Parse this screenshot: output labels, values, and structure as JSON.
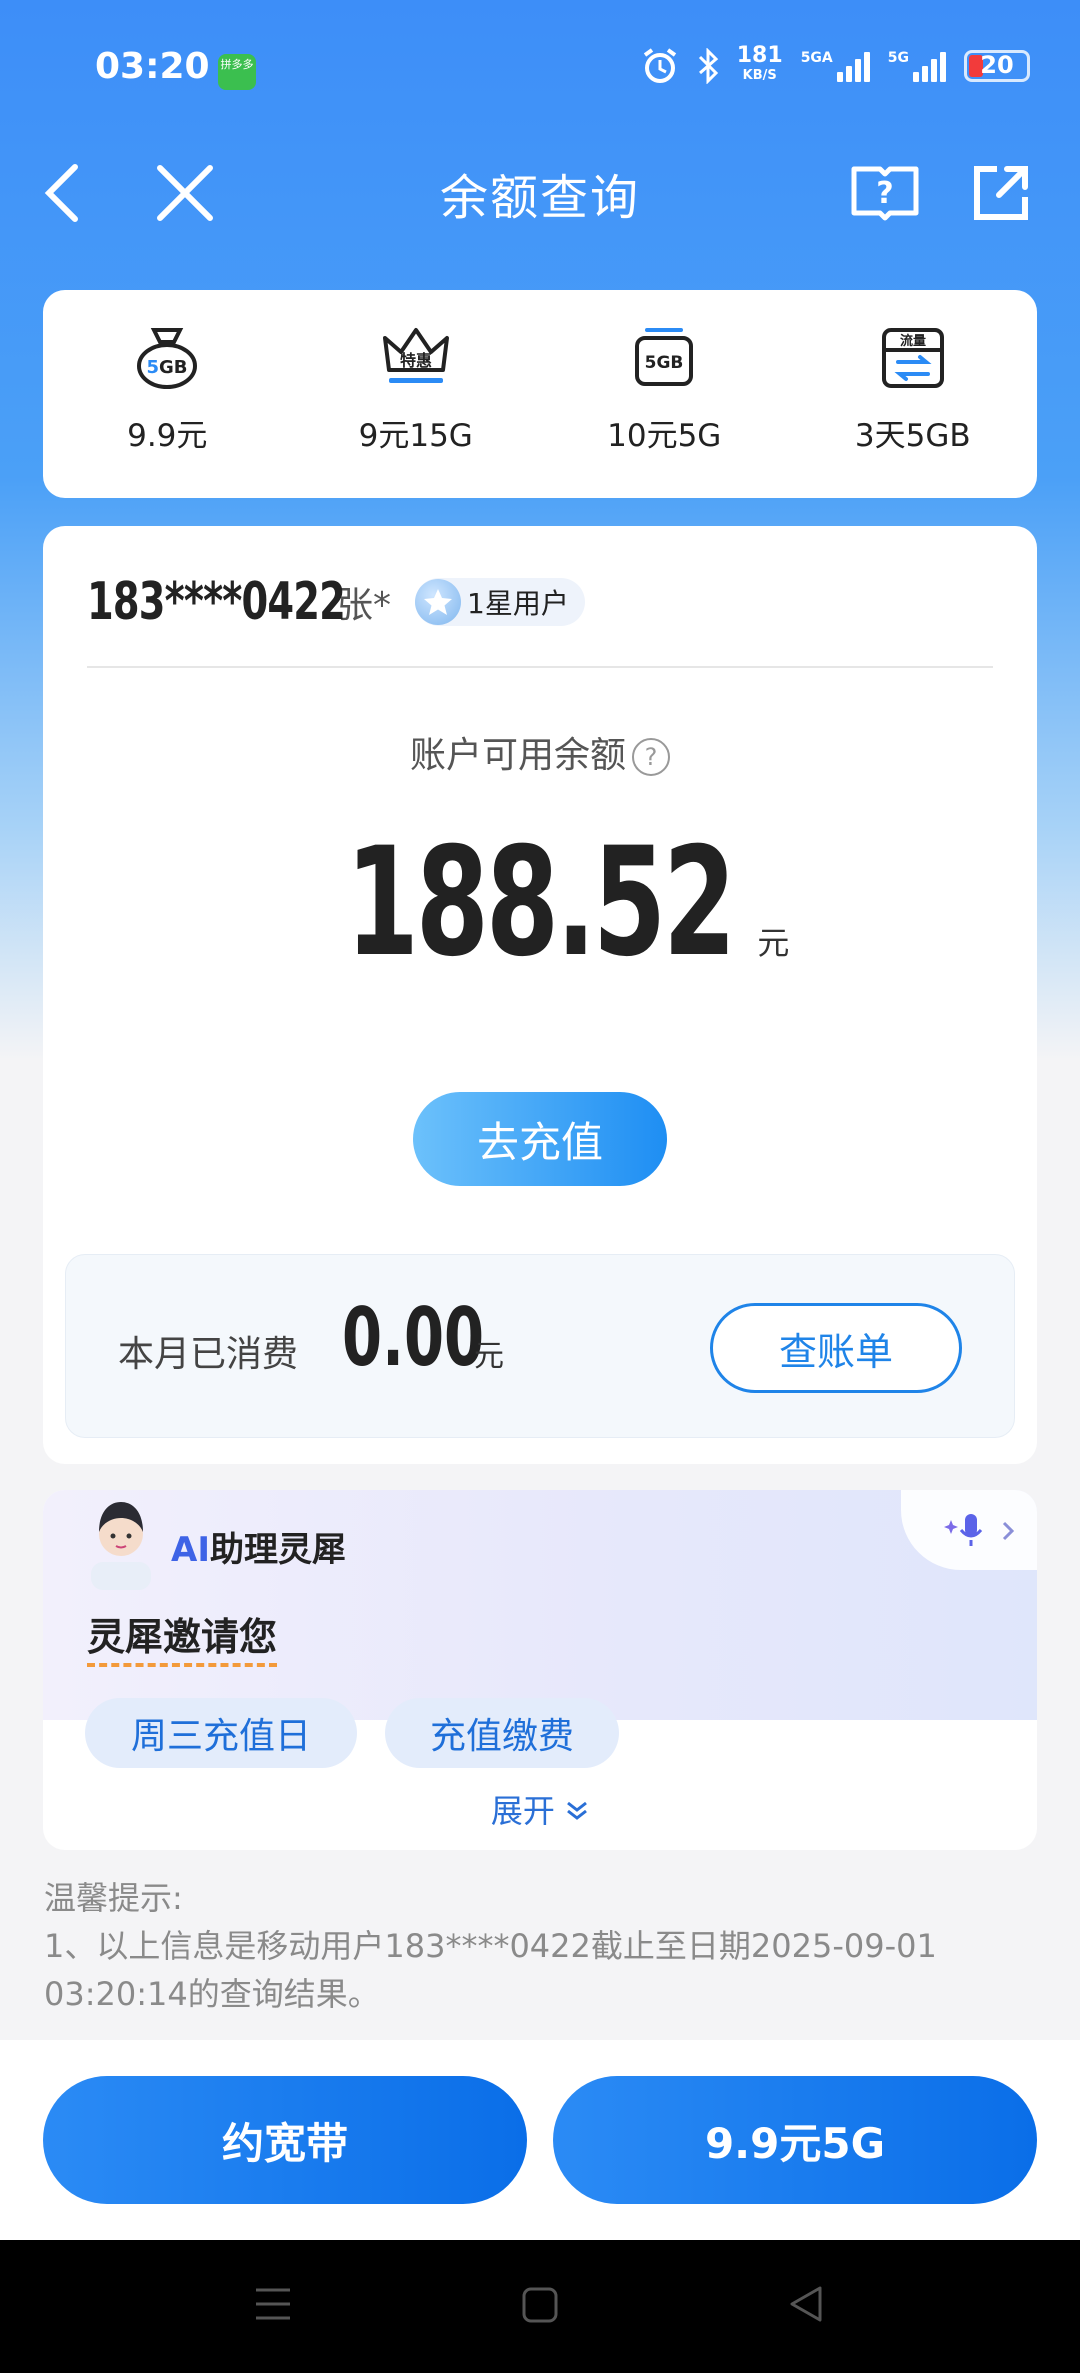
{
  "status_bar": {
    "time": "03:20",
    "app_badge": "拼多多",
    "net_speed": "181",
    "net_unit": "KB/S",
    "sig1": "5GA",
    "sig2": "5G",
    "battery": "20"
  },
  "nav": {
    "title": "余额查询"
  },
  "offers": [
    {
      "icon": "bag-5gb-icon",
      "label": "9.9元"
    },
    {
      "icon": "crown-discount-icon",
      "label": "9元15G"
    },
    {
      "icon": "sim-5gb-icon",
      "label": "10元5G"
    },
    {
      "icon": "data-traffic-icon",
      "label": "3天5GB"
    }
  ],
  "account": {
    "phone": "183****0422",
    "name": "张*",
    "tier": "1星用户",
    "available_label": "账户可用余额",
    "balance": "188.52",
    "unit": "元",
    "recharge_label": "去充值",
    "spent_label": "本月已消费",
    "spent": "0.00",
    "spent_unit": "元",
    "bill_label": "查账单"
  },
  "ai": {
    "prefix": "AI",
    "name": "助理灵犀",
    "invite": "灵犀邀请您",
    "chips": [
      "周三充值日",
      "充值缴费"
    ],
    "expand": "展开"
  },
  "tips": {
    "title": "温馨提示:",
    "line1": "1、以上信息是移动用户183****0422截止至日期2025-09-01 03:20:14的查询结果。"
  },
  "bottom": {
    "left": "约宽带",
    "right": "9.9元5G"
  },
  "colors": {
    "primary": "#1f84e8",
    "hero": "#3d8ef8",
    "accent": "#f39a3a"
  }
}
